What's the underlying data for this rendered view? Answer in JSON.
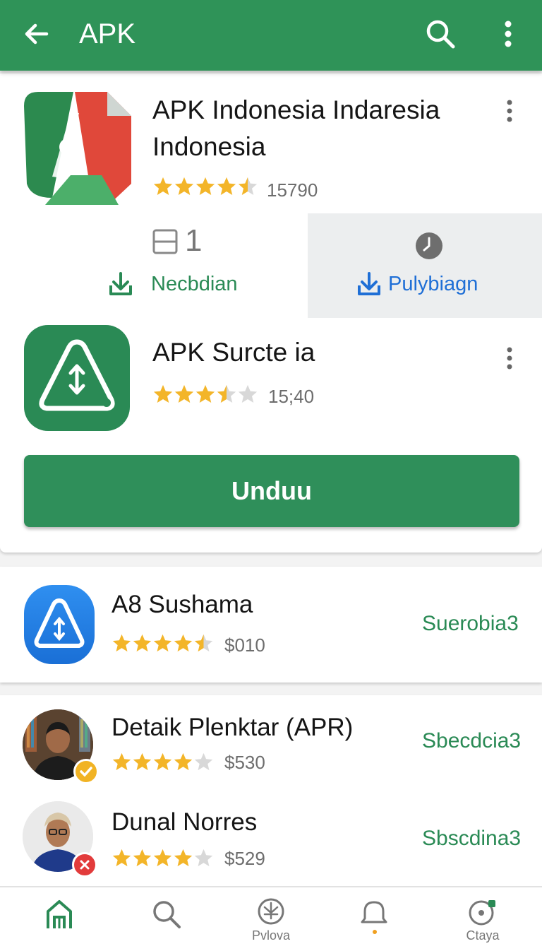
{
  "appbar": {
    "title": "APK"
  },
  "featured": {
    "app1": {
      "title": "APK Indonesia Indaresia Indonesia",
      "rating": 4.5,
      "rating_count": "15790"
    },
    "meta": {
      "count": "1",
      "download_label": "Necbdian",
      "secondary_label": "Pulybiagn"
    },
    "app2": {
      "title": "APK Surcte ia",
      "rating": 3.5,
      "rating_count": "15;40"
    },
    "download_button": "Unduu"
  },
  "list": [
    {
      "name": "A8 Sushama",
      "rating": 4.5,
      "price": "$010",
      "action": "Suerobia3"
    },
    {
      "name": "Detaik Plenktar (APR)",
      "rating": 4,
      "price": "$530",
      "action": "Sbecdcia3"
    },
    {
      "name": "Dunal Norres",
      "rating": 4,
      "price": "$529",
      "action": "Sbscdina3"
    }
  ],
  "bottom_nav": [
    {
      "icon": "home-icon",
      "label": ""
    },
    {
      "icon": "search-icon",
      "label": ""
    },
    {
      "icon": "download-circle-icon",
      "label": "Pvlova"
    },
    {
      "icon": "bell-icon",
      "label": ""
    },
    {
      "icon": "profile-icon",
      "label": "Ctaya"
    }
  ],
  "colors": {
    "primary": "#2f9358",
    "accent_blue": "#1f6fd6",
    "star": "#f3b529",
    "star_empty": "#d8d8d8"
  }
}
